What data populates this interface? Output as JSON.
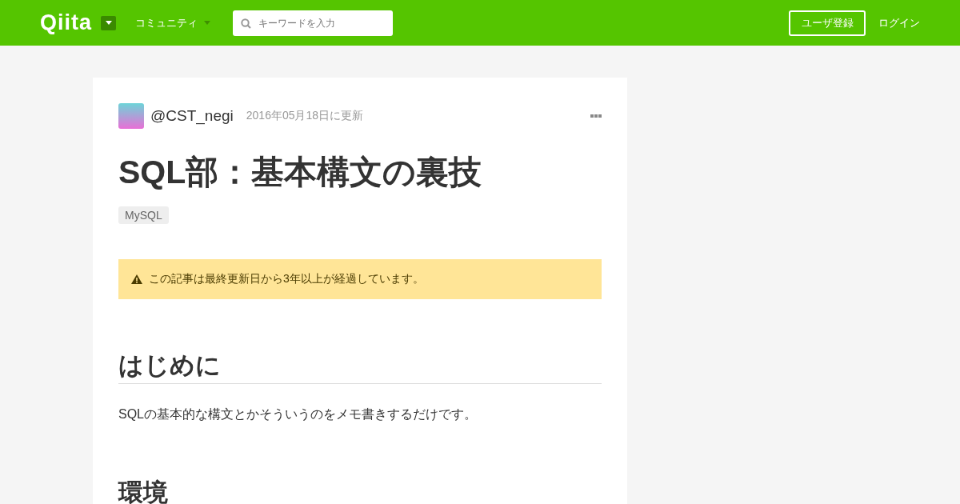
{
  "header": {
    "logo": "Qiita",
    "community": "コミュニティ",
    "search": {
      "placeholder": "キーワードを入力"
    },
    "signup": "ユーザ登録",
    "login": "ログイン"
  },
  "article": {
    "author": "@CST_negi",
    "updated": "2016年05月18日に更新",
    "title": "SQL部：基本構文の裏技",
    "tags": [
      "MySQL"
    ],
    "alert": "この記事は最終更新日から3年以上が経過しています。",
    "body": [
      {
        "kind": "heading",
        "text": "はじめに"
      },
      {
        "kind": "paragraph",
        "text": "SQLの基本的な構文とかそういうのをメモ書きするだけです。"
      },
      {
        "kind": "heading",
        "text": "環境"
      }
    ]
  }
}
